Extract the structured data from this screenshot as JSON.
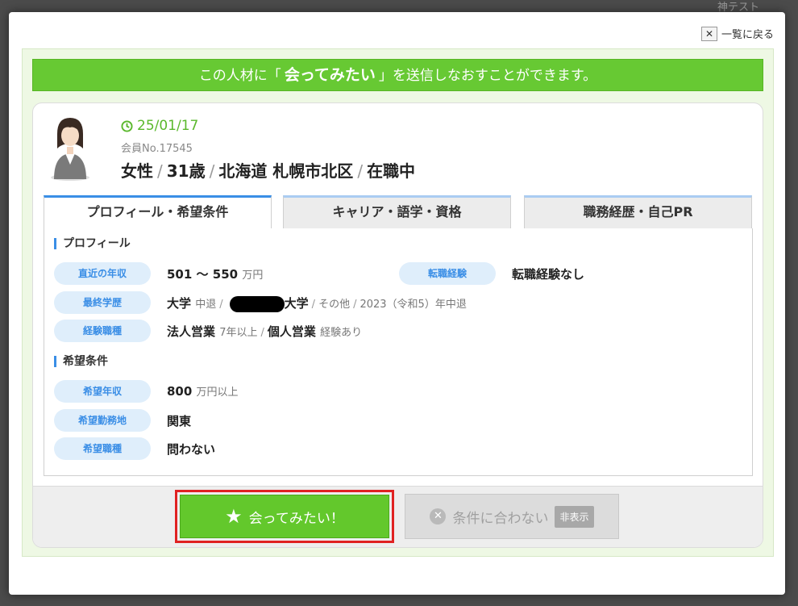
{
  "background": {
    "top_text": "神テスト"
  },
  "modal": {
    "back_label": "一覧に戻る",
    "back_icon": "close-icon"
  },
  "banner": {
    "prefix": "この人材に「",
    "strong": "会ってみたい",
    "suffix": "」を送信しなおすことができます。"
  },
  "candidate": {
    "date": "25/01/17",
    "member_no": "会員No.17545",
    "gender": "女性",
    "age": "31歳",
    "location": "北海道 札幌市北区",
    "status": "在職中"
  },
  "tabs": [
    {
      "label": "プロフィール・希望条件",
      "active": true
    },
    {
      "label": "キャリア・語学・資格",
      "active": false
    },
    {
      "label": "職務経歴・自己PR",
      "active": false
    }
  ],
  "profile": {
    "section_title": "プロフィール",
    "income_label": "直近の年収",
    "income_value": "501 ～ 550",
    "income_unit": "万円",
    "job_change_label": "転職経験",
    "job_change_value": "転職経験なし",
    "education_label": "最終学歴",
    "education_main": "大学",
    "education_sub": "中退",
    "education_school": "大学",
    "education_other": "その他",
    "education_year": "2023（令和5）年中退",
    "experience_label": "経験職種",
    "exp1": "法人営業",
    "exp1_sub": "7年以上",
    "exp2": "個人営業",
    "exp2_sub": "経験あり"
  },
  "wishes": {
    "section_title": "希望条件",
    "income_label": "希望年収",
    "income_value": "800",
    "income_unit": "万円以上",
    "location_label": "希望勤務地",
    "location_value": "関東",
    "job_label": "希望職種",
    "job_value": "問わない"
  },
  "footer": {
    "meet_label": "会ってみたい！",
    "reject_label": "条件に合わない",
    "hide_badge": "非表示"
  }
}
